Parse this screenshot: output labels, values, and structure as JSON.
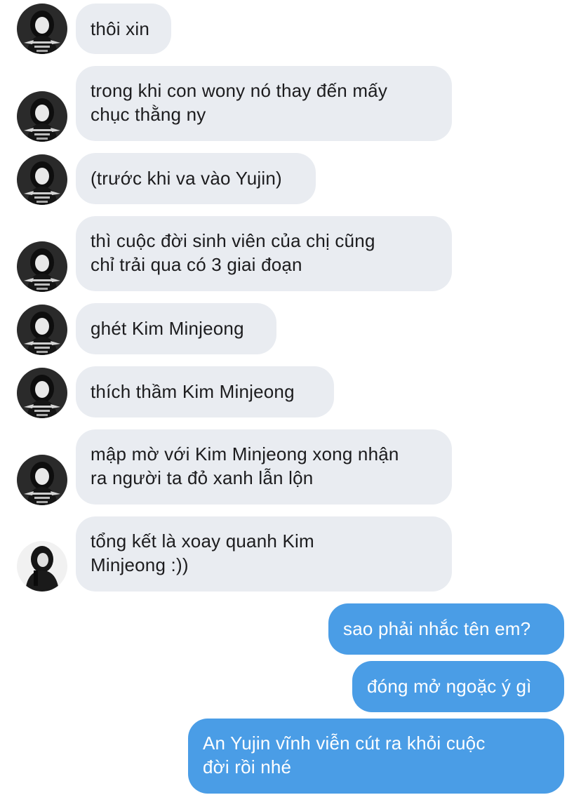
{
  "messages": [
    {
      "sender": "them",
      "avatar": "avatar-photo-a",
      "lines": [
        "thôi xin"
      ]
    },
    {
      "sender": "them",
      "avatar": "avatar-photo-a",
      "lines": [
        "trong khi con wony nó thay đến mấy",
        "chục thằng ny"
      ]
    },
    {
      "sender": "them",
      "avatar": "avatar-photo-a",
      "lines": [
        "(trước khi va vào Yujin)"
      ]
    },
    {
      "sender": "them",
      "avatar": "avatar-photo-a",
      "lines": [
        "thì cuộc đời sinh viên của chị cũng",
        "chỉ trải qua có 3 giai đoạn"
      ]
    },
    {
      "sender": "them",
      "avatar": "avatar-photo-a",
      "lines": [
        "ghét Kim Minjeong"
      ]
    },
    {
      "sender": "them",
      "avatar": "avatar-photo-a",
      "lines": [
        "thích thầm Kim Minjeong"
      ]
    },
    {
      "sender": "them",
      "avatar": "avatar-photo-a",
      "lines": [
        "mập mờ với Kim Minjeong xong nhận",
        "ra người ta đỏ xanh lẫn lộn"
      ]
    },
    {
      "sender": "them",
      "avatar": "avatar-photo-b",
      "lines": [
        "tổng kết là xoay quanh Kim",
        "Minjeong :))"
      ]
    },
    {
      "sender": "me",
      "lines": [
        "sao phải nhắc tên em?"
      ]
    },
    {
      "sender": "me",
      "lines": [
        "đóng mở ngoặc ý gì"
      ]
    },
    {
      "sender": "me",
      "lines": [
        "An Yujin vĩnh viễn cút ra khỏi cuộc",
        "đời rồi nhé"
      ]
    }
  ],
  "colors": {
    "incoming_bubble": "#e9ecf1",
    "outgoing_bubble": "#4a9de6",
    "incoming_text": "#1c1c1e",
    "outgoing_text": "#ffffff"
  }
}
